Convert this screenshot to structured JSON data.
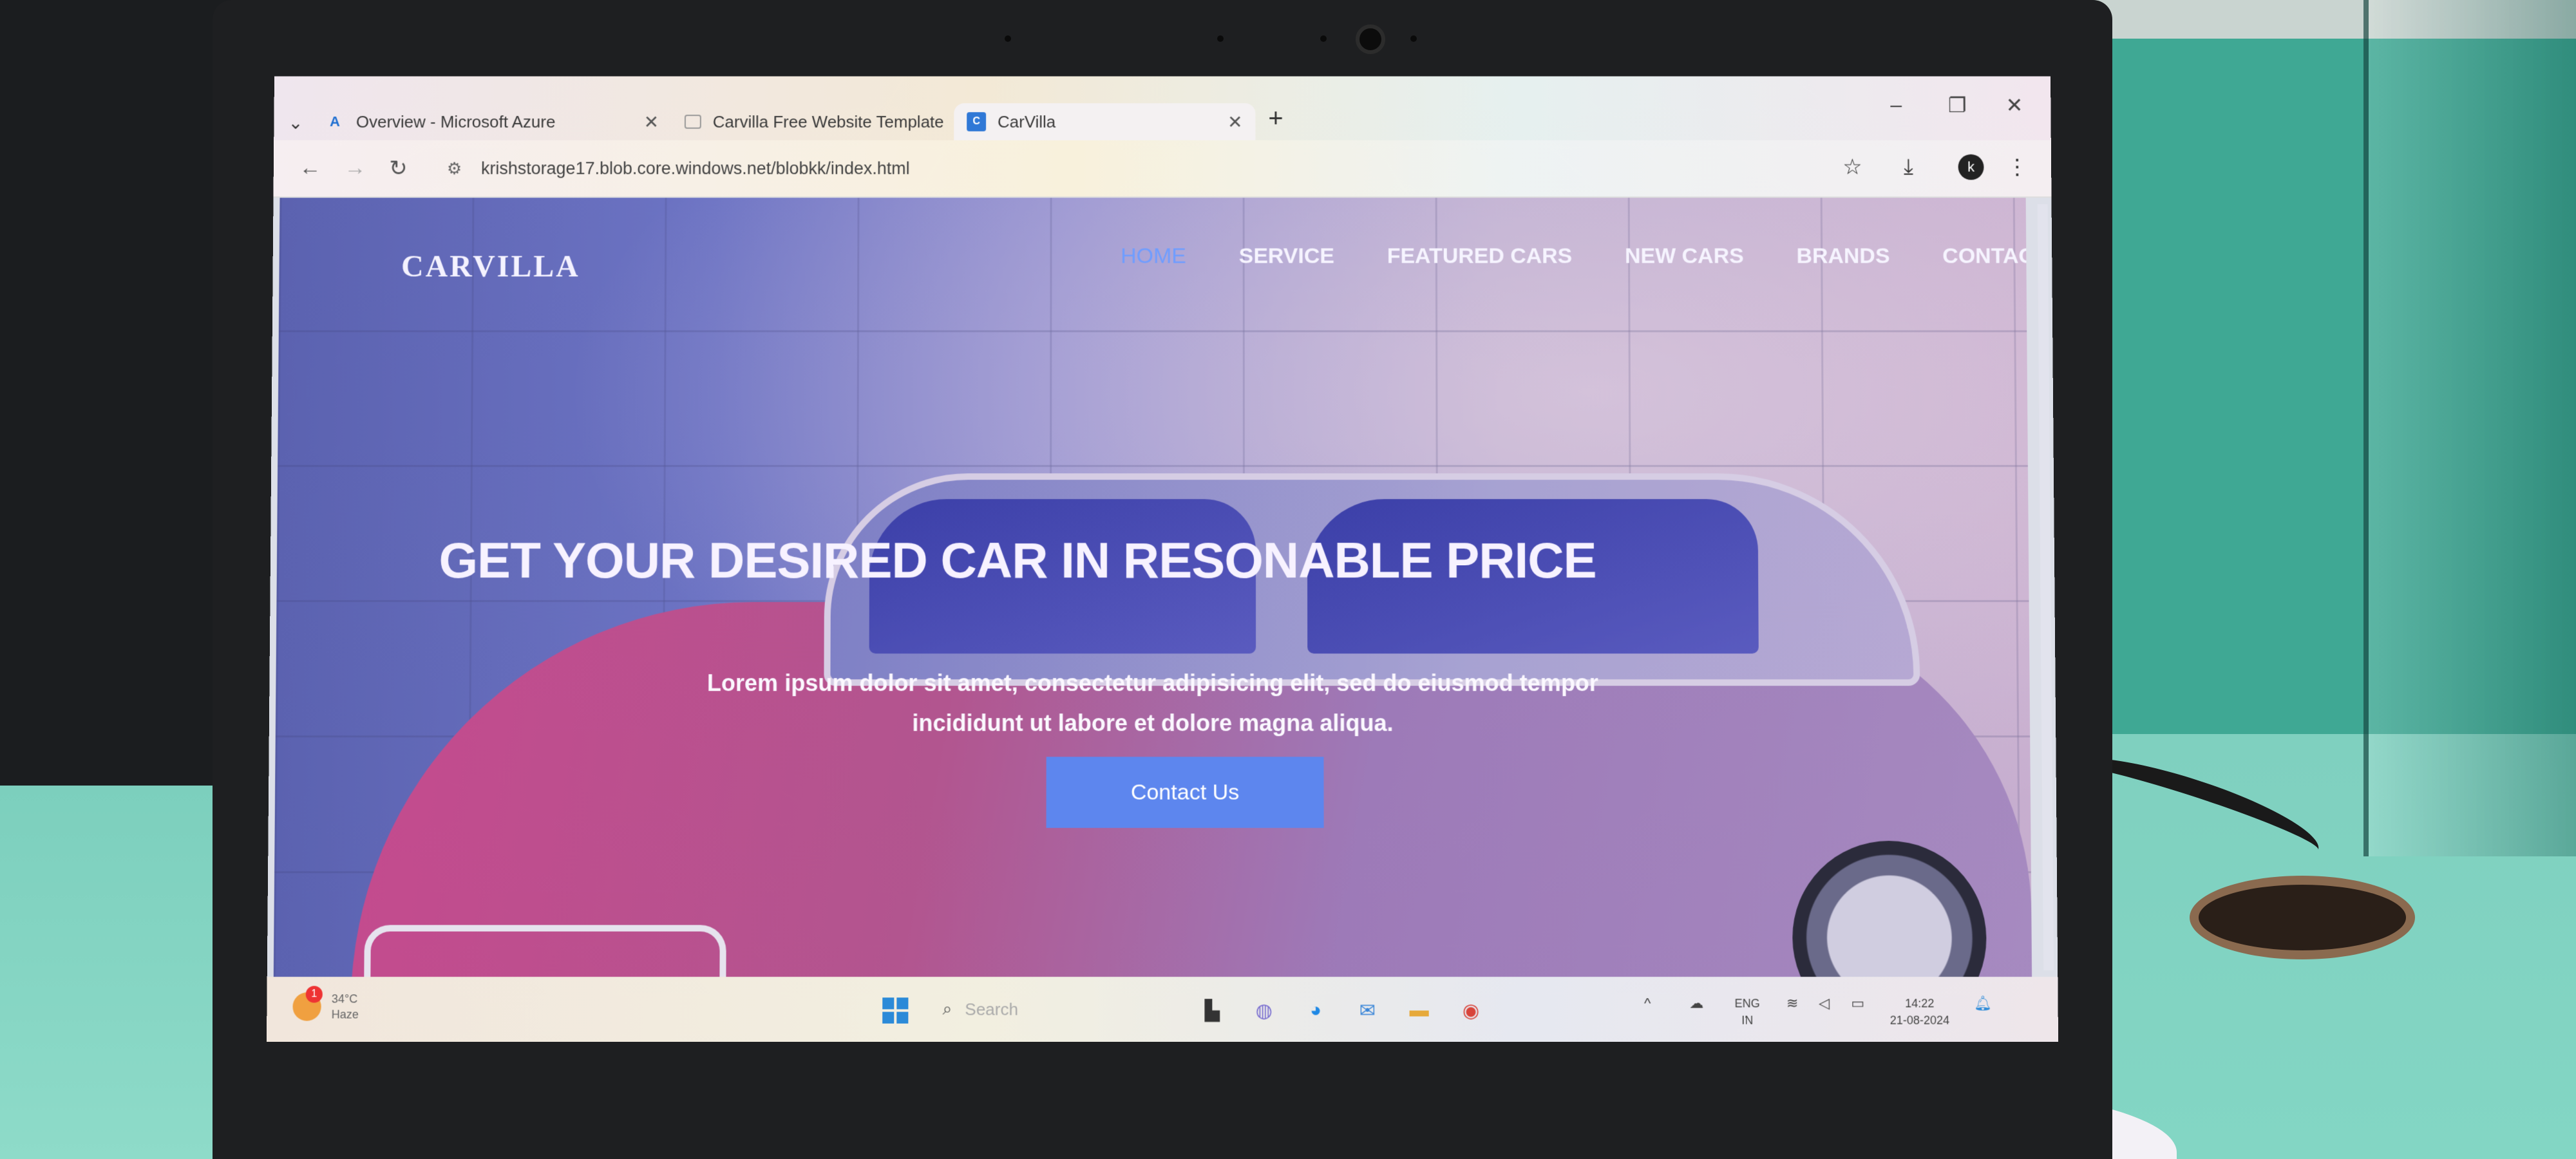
{
  "browser": {
    "tabs": [
      {
        "title": "Overview - Microsoft Azure",
        "icon": "azure-icon",
        "active": false
      },
      {
        "title": "Carvilla Free Website Template",
        "icon": "page-icon",
        "active": false
      },
      {
        "title": "CarVilla",
        "icon": "carvilla-favicon",
        "active": true
      }
    ],
    "new_tab_label": "+",
    "url": "krishstorage17.blob.core.windows.net/blobkk/index.html",
    "profile_initial": "k"
  },
  "site": {
    "brand": "CARVILLA",
    "nav": [
      {
        "label": "HOME",
        "active": true
      },
      {
        "label": "SERVICE",
        "active": false
      },
      {
        "label": "FEATURED CARS",
        "active": false
      },
      {
        "label": "NEW CARS",
        "active": false
      },
      {
        "label": "BRANDS",
        "active": false
      },
      {
        "label": "CONTACT",
        "active": false
      }
    ],
    "hero": {
      "title": "GET YOUR DESIRED CAR IN RESONABLE PRICE",
      "text_line1": "Lorem ipsum dolor sit amet, consectetur adipisicing elit, sed do eiusmod tempor",
      "text_line2": "incididunt ut labore et dolore magna aliqua.",
      "button": "Contact Us"
    },
    "accent_color": "#5d86ee"
  },
  "taskbar": {
    "weather_temp": "34°C",
    "weather_desc": "Haze",
    "weather_badge": "1",
    "search_placeholder": "Search",
    "lang": "ENG",
    "region": "IN",
    "time": "14:22",
    "date": "21-08-2024"
  }
}
